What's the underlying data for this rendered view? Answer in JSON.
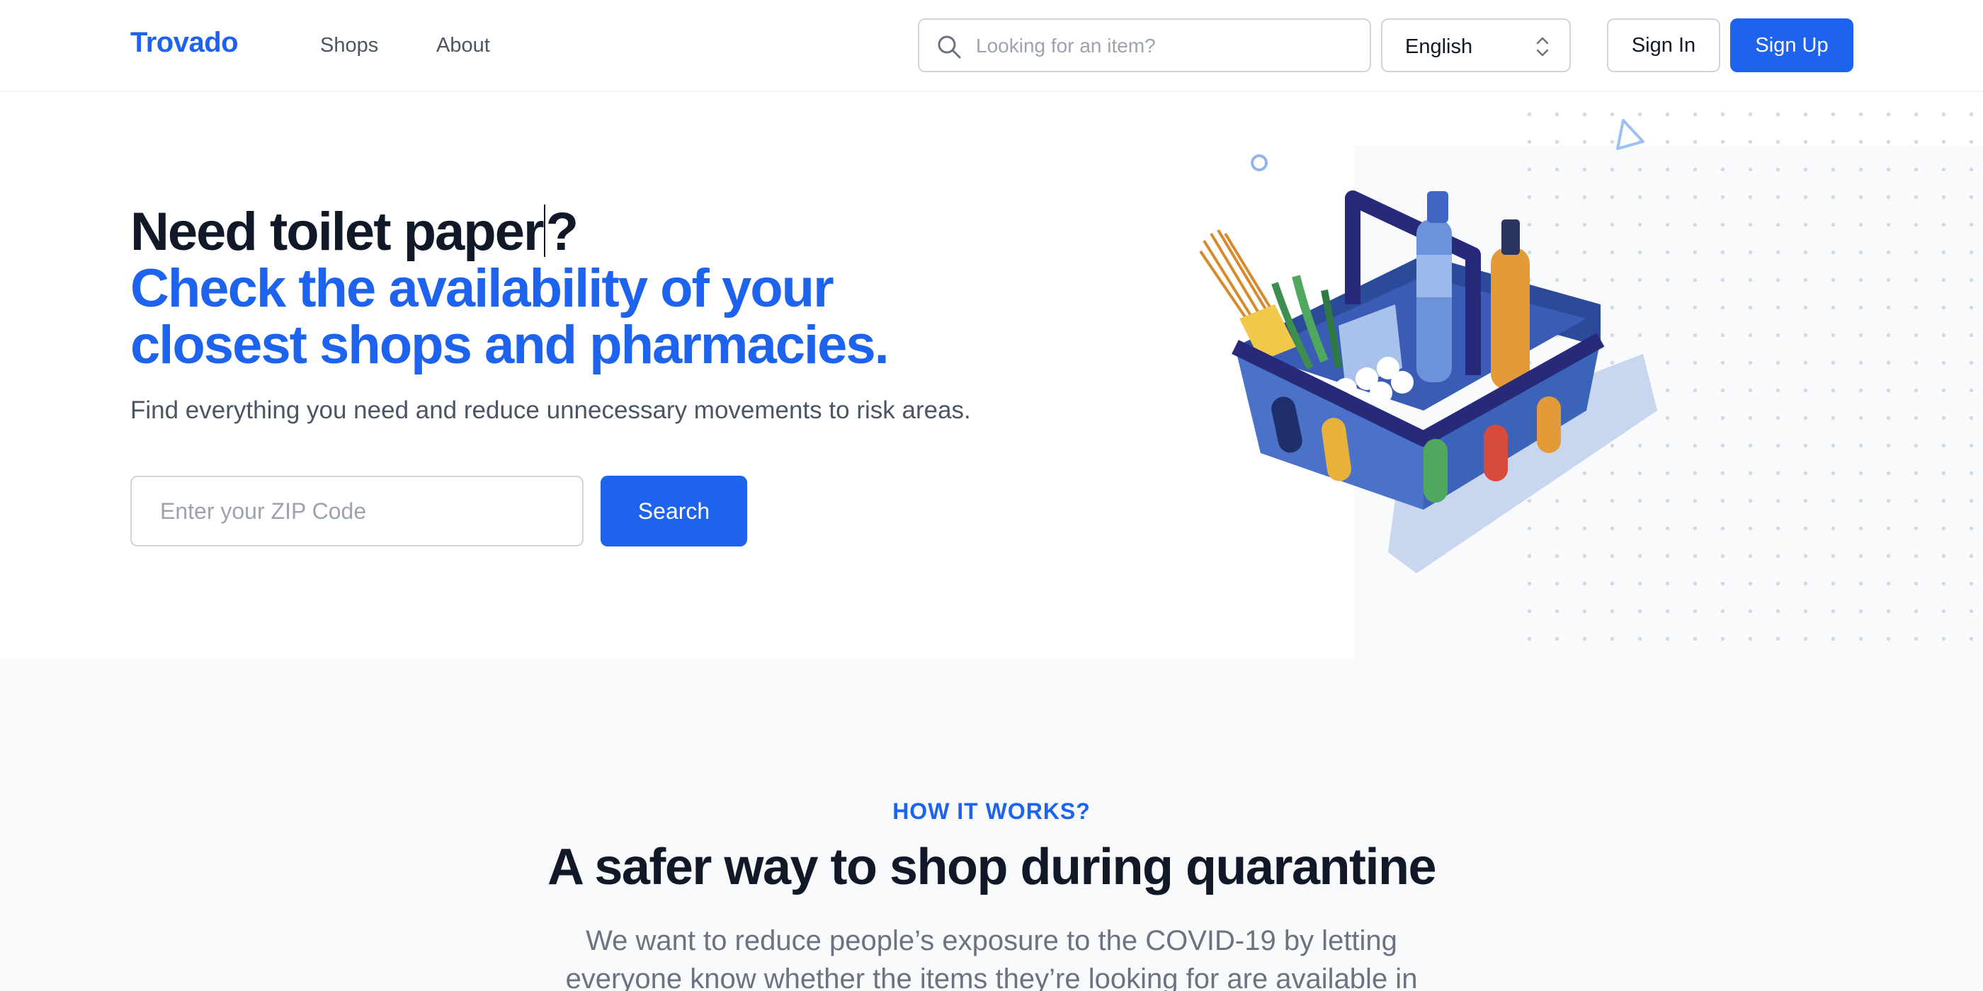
{
  "header": {
    "logo": "Trovado",
    "nav": {
      "shops": "Shops",
      "about": "About"
    },
    "search_placeholder": "Looking for an item?",
    "language": "English",
    "sign_in": "Sign In",
    "sign_up": "Sign Up"
  },
  "hero": {
    "title_before_caret": "Need toilet paper",
    "title_after_caret": "?",
    "title_line2": "Check the availability of your",
    "title_line3": "closest shops and pharmacies.",
    "subtitle": "Find everything you need and reduce unnecessary movements to risk areas.",
    "zip_placeholder": "Enter your ZIP Code",
    "search_button": "Search",
    "illustration": "shopping-basket-illustration"
  },
  "how_it_works": {
    "eyebrow": "HOW IT WORKS?",
    "title": "A safer way to shop during quarantine",
    "description": "We want to reduce people’s exposure to the COVID-19 by letting everyone know whether the items they’re looking for are available in"
  },
  "colors": {
    "brand": "#1d63ed",
    "text_dark": "#111827",
    "text_muted": "#4b5563",
    "section_bg": "#f8fafc"
  },
  "icons": [
    "search-icon",
    "select-chevron-icon"
  ]
}
